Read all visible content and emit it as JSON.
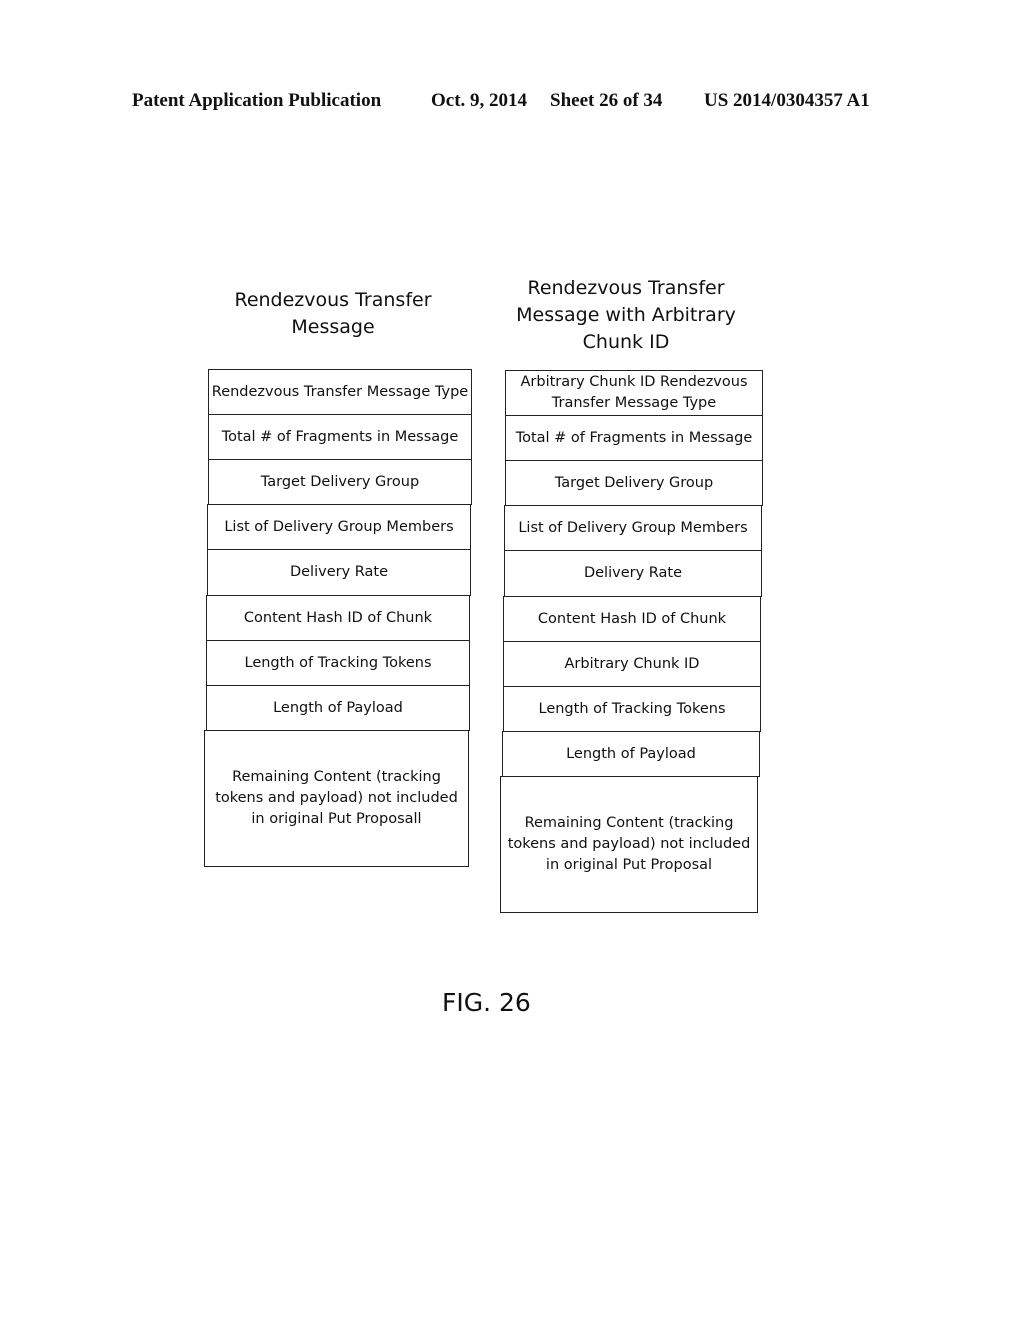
{
  "header": {
    "publication": "Patent Application Publication",
    "date": "Oct. 9, 2014",
    "sheet": "Sheet 26 of 34",
    "number": "US 2014/0304357 A1"
  },
  "left": {
    "title_line1": "Rendezvous Transfer",
    "title_line2": "Message",
    "fields": [
      "Rendezvous Transfer Message Type",
      "Total # of Fragments in Message",
      "Target Delivery Group",
      "List of Delivery Group Members",
      "Delivery Rate",
      "Content Hash ID of Chunk",
      "Length of Tracking Tokens",
      "Length of Payload",
      "Remaining Content (tracking tokens and payload) not included in original Put Proposall"
    ]
  },
  "right": {
    "title_line1": "Rendezvous Transfer",
    "title_line2": "Message with Arbitrary",
    "title_line3": "Chunk ID",
    "fields": [
      "Arbitrary Chunk ID Rendezvous Transfer Message Type",
      "Total # of Fragments in Message",
      "Target Delivery Group",
      "List of Delivery Group Members",
      "Delivery Rate",
      "Content Hash ID of Chunk",
      "Arbitrary Chunk ID",
      "Length of Tracking Tokens",
      "Length of Payload",
      "Remaining Content (tracking tokens and payload) not included in original Put Proposal"
    ]
  },
  "figure_label": "FIG. 26"
}
